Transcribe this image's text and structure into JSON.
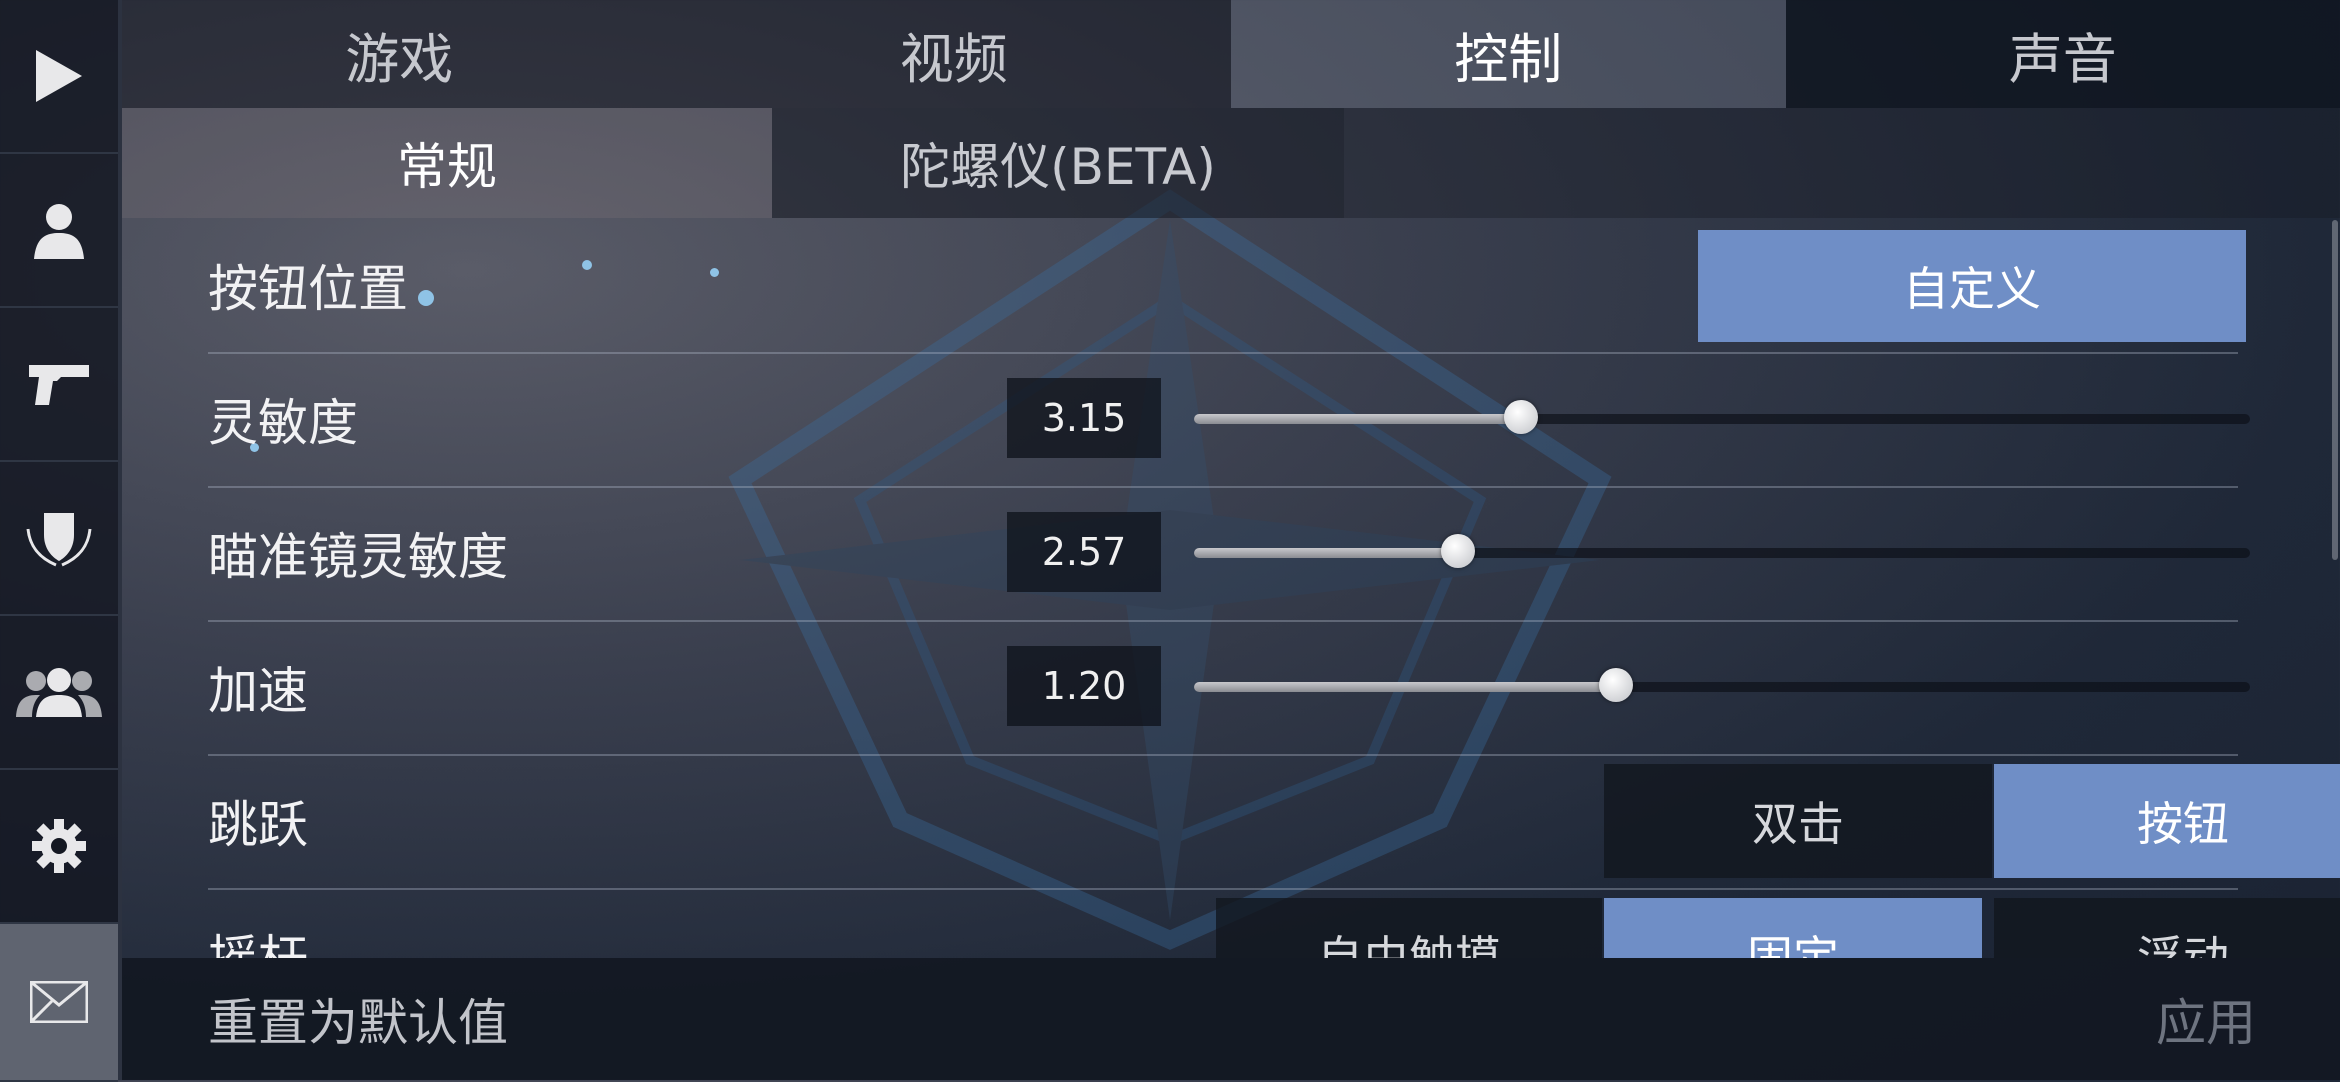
{
  "sidebar": {
    "items": [
      {
        "icon": "play-icon",
        "active": false
      },
      {
        "icon": "profile-icon",
        "active": false
      },
      {
        "icon": "pistol-icon",
        "active": false
      },
      {
        "icon": "shield-emblem-icon",
        "active": false
      },
      {
        "icon": "friends-icon",
        "active": false
      },
      {
        "icon": "gear-icon",
        "active": false
      },
      {
        "icon": "mail-icon",
        "active": true
      }
    ]
  },
  "tabs": [
    {
      "label": "游戏"
    },
    {
      "label": "视频"
    },
    {
      "label": "控制",
      "active": true
    },
    {
      "label": "声音"
    }
  ],
  "subtabs": [
    {
      "label": "常规",
      "active": true
    },
    {
      "label": "陀螺仪(BETA)"
    }
  ],
  "settings": {
    "button_position": {
      "label": "按钮位置",
      "button": "自定义"
    },
    "sensitivity": {
      "label": "灵敏度",
      "value": "3.15",
      "fill": 0.31
    },
    "scope_sensitivity": {
      "label": "瞄准镜灵敏度",
      "value": "2.57",
      "fill": 0.25
    },
    "acceleration": {
      "label": "加速",
      "value": "1.20",
      "fill": 0.4
    },
    "jump": {
      "label": "跳跃",
      "options": [
        "双击",
        "按钮"
      ],
      "selected": "按钮"
    },
    "joystick": {
      "label": "摇杆",
      "options": [
        "自由触摸",
        "固定",
        "浮动"
      ],
      "selected": "固定"
    }
  },
  "footer": {
    "reset": "重置为默认值",
    "apply": "应用"
  },
  "colors": {
    "accent": "#6f8ec6"
  }
}
